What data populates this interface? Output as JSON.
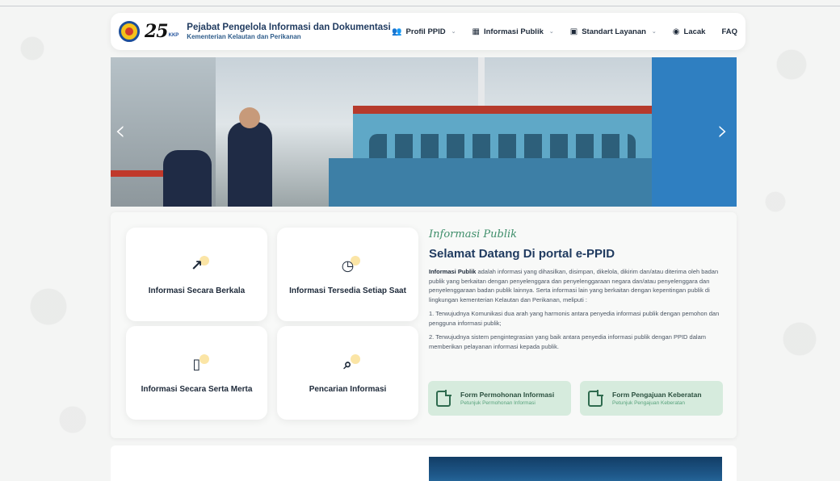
{
  "header": {
    "logo_text": "25",
    "logo_sub": "KKP",
    "title": "Pejabat Pengelola Informasi dan Dokumentasi",
    "subtitle": "Kementerian Kelautan dan Perikanan",
    "nav": [
      {
        "label": "Profil PPID",
        "icon": "people-icon",
        "dropdown": true
      },
      {
        "label": "Informasi Publik",
        "icon": "grid-icon",
        "dropdown": true
      },
      {
        "label": "Standart Layanan",
        "icon": "book-icon",
        "dropdown": true
      },
      {
        "label": "Lacak",
        "icon": "radar-icon",
        "dropdown": false
      },
      {
        "label": "FAQ",
        "icon": "",
        "dropdown": false
      }
    ]
  },
  "hero": {
    "prev_arrow": "‹",
    "next_arrow": "›"
  },
  "tiles": [
    {
      "label": "Informasi Secara Berkala",
      "icon": "trend-up-icon",
      "glyph": "↗"
    },
    {
      "label": "Informasi Tersedia Setiap Saat",
      "icon": "clock-icon",
      "glyph": "◷"
    },
    {
      "label": "Informasi Secara Serta Merta",
      "icon": "clipboard-icon",
      "glyph": "▯"
    },
    {
      "label": "Pencarian Informasi",
      "icon": "search-icon",
      "glyph": "⌕"
    }
  ],
  "info": {
    "kicker": "Informasi Publik",
    "title": "Selamat Datang Di portal e-PPID",
    "body_bold": "Informasi Publik",
    "body_rest": " adalah informasi yang dihasilkan, disimpan, dikelola, dikirim dan/atau diterima oleh badan publik yang berkaitan dengan penyelenggara dan penyelenggaraan negara dan/atau penyelenggara dan penyelenggaraan badan publik lainnya. Serta informasi lain yang berkaitan dengan kepentingan publik di lingkungan kementerian Kelautan dan Perikanan, meliputi :",
    "points": [
      "1. Terwujudnya Komunikasi dua arah yang harmonis antara penyedia informasi publik dengan pemohon dan pengguna informasi publik;",
      "2. Terwujudnya sistem pengintegrasian yang baik antara penyedia informasi publik dengan PPID dalam memberikan pelayanan informasi kepada publik."
    ]
  },
  "forms": [
    {
      "title": "Form Permohonan Informasi",
      "sub": "Petunjuk Permohonan Informasi"
    },
    {
      "title": "Form Pengajuan Keberatan",
      "sub": "Petunjuk Pengajuan Keberatan"
    }
  ],
  "colors": {
    "accent_green": "#3e8e6a",
    "form_bg": "#d6ebdd",
    "title_blue": "#1f3a5f"
  }
}
